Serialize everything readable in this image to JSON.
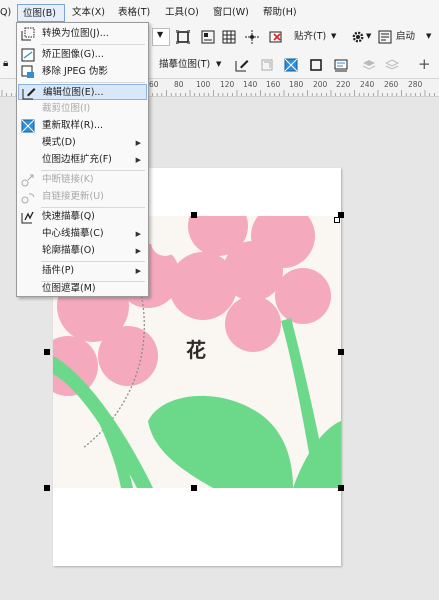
{
  "menubar": {
    "items": [
      {
        "label": "Q)"
      },
      {
        "label": "位图(B)"
      },
      {
        "label": "文本(X)"
      },
      {
        "label": "表格(T)"
      },
      {
        "label": "工具(O)"
      },
      {
        "label": "窗口(W)"
      },
      {
        "label": "帮助(H)"
      }
    ]
  },
  "toolbar1": {
    "paste_label": "贴齐(T)",
    "launch_label": "启动"
  },
  "toolbar2": {
    "trace_label": "描摹位图(T)"
  },
  "ruler": {
    "labels": [
      "60",
      "80",
      "100",
      "120",
      "140",
      "160",
      "180",
      "200",
      "220",
      "240",
      "260",
      "280"
    ]
  },
  "canvas": {
    "flower_text": "花"
  },
  "bitmap_menu": {
    "items": [
      {
        "label": "转换为位图(J)...",
        "icon": "convert-bitmap-icon",
        "enabled": true
      },
      {
        "label": "矫正图像(G)...",
        "icon": "straighten-image-icon",
        "enabled": true
      },
      {
        "label": "移除 JPEG 伪影",
        "icon": "remove-jpeg-artifacts-icon",
        "enabled": true
      },
      {
        "label": "编辑位图(E)...",
        "icon": "edit-bitmap-icon",
        "enabled": true,
        "highlighted": true
      },
      {
        "label": "裁剪位图(I)",
        "icon": "",
        "enabled": false
      },
      {
        "label": "重新取样(R)...",
        "icon": "resample-icon",
        "enabled": true
      },
      {
        "label": "模式(D)",
        "icon": "",
        "enabled": true,
        "submenu": true
      },
      {
        "label": "位图边框扩充(F)",
        "icon": "",
        "enabled": true,
        "submenu": true
      },
      {
        "label": "中断链接(K)",
        "icon": "break-link-icon",
        "enabled": false
      },
      {
        "label": "自链接更新(U)",
        "icon": "update-link-icon",
        "enabled": false
      },
      {
        "label": "快速描摹(Q)",
        "icon": "quick-trace-icon",
        "enabled": true
      },
      {
        "label": "中心线描摹(C)",
        "icon": "",
        "enabled": true,
        "submenu": true
      },
      {
        "label": "轮廓描摹(O)",
        "icon": "",
        "enabled": true,
        "submenu": true
      },
      {
        "label": "插件(P)",
        "icon": "",
        "enabled": true,
        "submenu": true
      },
      {
        "label": "位图遮罩(M)",
        "icon": "",
        "enabled": true
      }
    ]
  },
  "colors": {
    "highlight": "#d9e8f8",
    "pink": "#f5a9bd",
    "green": "#6cd98a",
    "cream": "#faf6f1"
  }
}
